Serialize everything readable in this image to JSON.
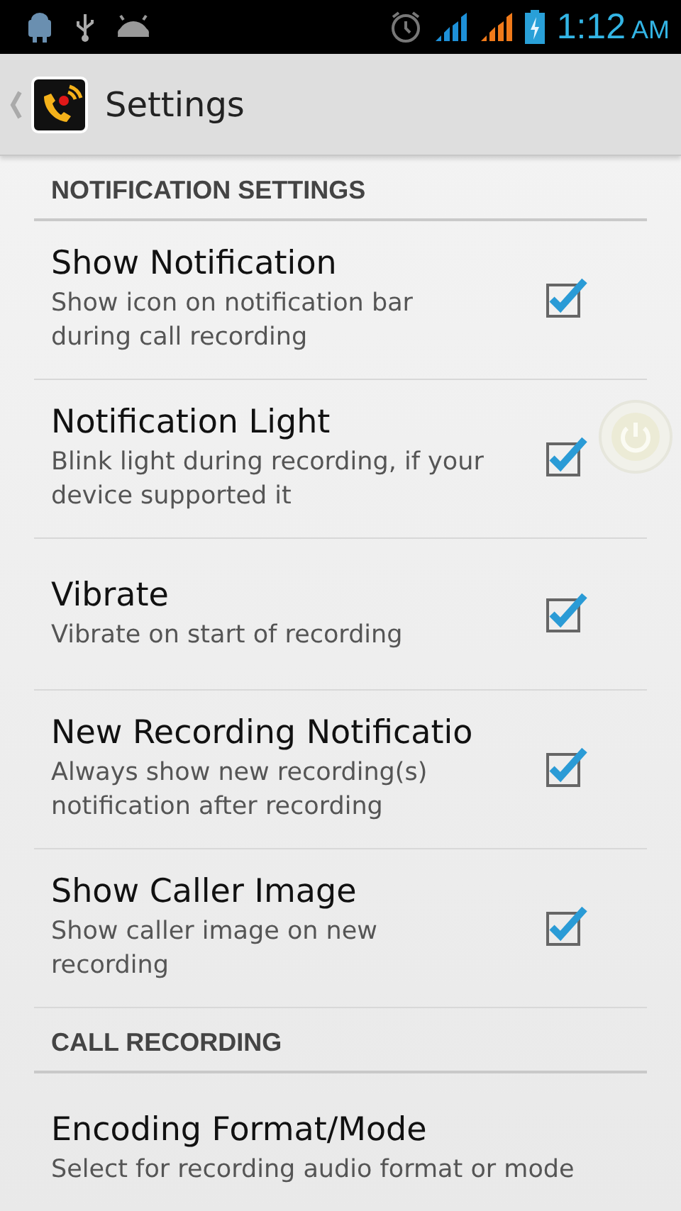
{
  "status_bar": {
    "time": "1:12",
    "ampm": "AM"
  },
  "action_bar": {
    "title": "Settings"
  },
  "sections": [
    {
      "header": "NOTIFICATION SETTINGS",
      "items": [
        {
          "title": "Show Notification",
          "summary": "Show icon on notification bar during call recording",
          "checked": true
        },
        {
          "title": "Notification Light",
          "summary": "Blink light during recording, if your device supported it",
          "checked": true
        },
        {
          "title": "Vibrate",
          "summary": "Vibrate on start of recording",
          "checked": true
        },
        {
          "title": "New Recording Notificatio",
          "summary": "Always show new recording(s) notification after recording",
          "checked": true
        },
        {
          "title": "Show Caller Image",
          "summary": "Show caller image on new recording",
          "checked": true
        }
      ]
    },
    {
      "header": "CALL RECORDING",
      "items": [
        {
          "title": "Encoding Format/Mode",
          "summary": "Select for recording audio format or mode"
        }
      ]
    }
  ]
}
